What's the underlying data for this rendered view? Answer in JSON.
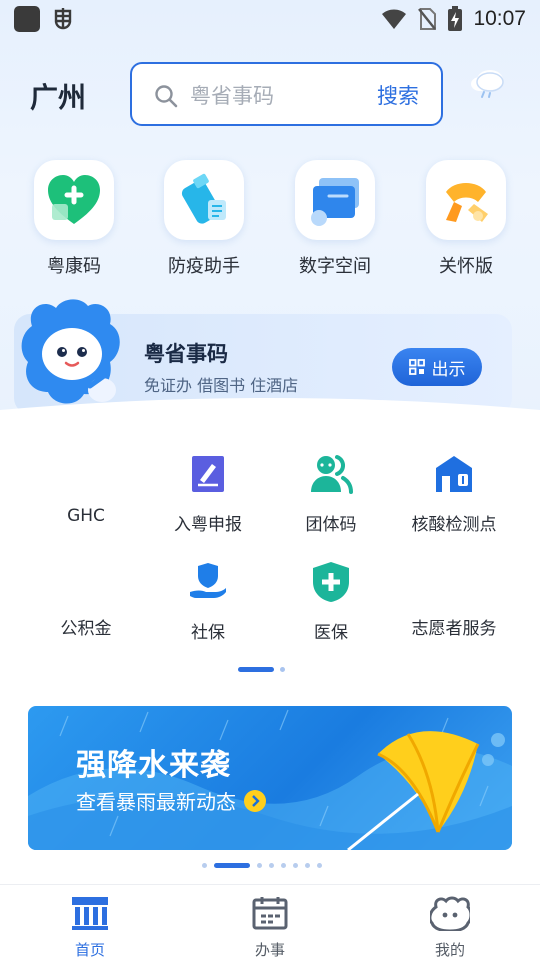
{
  "status_bar": {
    "time": "10:07",
    "icons": [
      "app-square-icon",
      "bug-icon",
      "wifi-icon",
      "no-sim-icon",
      "battery-charging-icon"
    ]
  },
  "header": {
    "city": "广州",
    "search": {
      "placeholder": "粤省事码",
      "button_label": "搜索"
    },
    "weather_icon": "cloud-icon"
  },
  "quick_actions": [
    {
      "label": "粤康码",
      "icon": "green-heart-icon"
    },
    {
      "label": "防疫助手",
      "icon": "spray-bottle-icon"
    },
    {
      "label": "数字空间",
      "icon": "folders-icon"
    },
    {
      "label": "关怀版",
      "icon": "scarf-icon"
    }
  ],
  "code_card": {
    "title": "粤省事码",
    "subtitle": "免证办 借图书 住酒店",
    "button_label": "出示"
  },
  "services": [
    {
      "label": "GHC",
      "icon": "none"
    },
    {
      "label": "入粤申报",
      "icon": "edit-form-icon"
    },
    {
      "label": "团体码",
      "icon": "group-people-icon"
    },
    {
      "label": "核酸检测点",
      "icon": "test-station-icon"
    },
    {
      "label": "公积金",
      "icon": "none"
    },
    {
      "label": "社保",
      "icon": "social-security-hand-icon"
    },
    {
      "label": "医保",
      "icon": "medical-shield-icon"
    },
    {
      "label": "志愿者服务",
      "icon": "none"
    }
  ],
  "banner": {
    "title": "强降水来袭",
    "subtitle": "查看暴雨最新动态"
  },
  "bottom_nav": [
    {
      "label": "首页",
      "icon": "home-building-icon",
      "active": true
    },
    {
      "label": "办事",
      "icon": "calendar-icon",
      "active": false
    },
    {
      "label": "我的",
      "icon": "mascot-face-icon",
      "active": false
    }
  ],
  "colors": {
    "accent": "#2d6fe0",
    "service_purple": "#5a5ee0",
    "service_teal": "#1cb59a",
    "service_blue": "#1f6fe0",
    "banner_yellow": "#ffcf1c"
  }
}
